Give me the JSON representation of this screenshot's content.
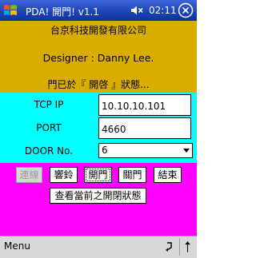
{
  "titlebar": {
    "title": "PDA! 開門! v1.1",
    "clock": "02:11"
  },
  "info": {
    "company": "台京科技開發有限公司",
    "designer": "Designer : Danny Lee.",
    "door_status": "門已於『 開啓 』狀態..."
  },
  "connection": {
    "ip_label": "TCP IP",
    "ip_value": "10.10.10.101",
    "port_label": "PORT",
    "port_value": "4660",
    "door_label": "DOOR No.",
    "door_value": "6"
  },
  "buttons": {
    "connect": "連線",
    "bell": "響鈴",
    "open": "開門",
    "close": "關門",
    "end": "結束",
    "query": "查看當前之開閉狀態"
  },
  "menubar": {
    "menu": "Menu"
  },
  "colors": {
    "info_bg": "#d9ad00",
    "conn_bg": "#00ffff",
    "btn_bg": "#ff00ff",
    "titlebar": "#1c44b8"
  },
  "icons": {
    "start": "windows-flag-icon",
    "volume": "speaker-muted-icon",
    "close": "ok-close-icon",
    "sip": "keyboard-icon"
  }
}
